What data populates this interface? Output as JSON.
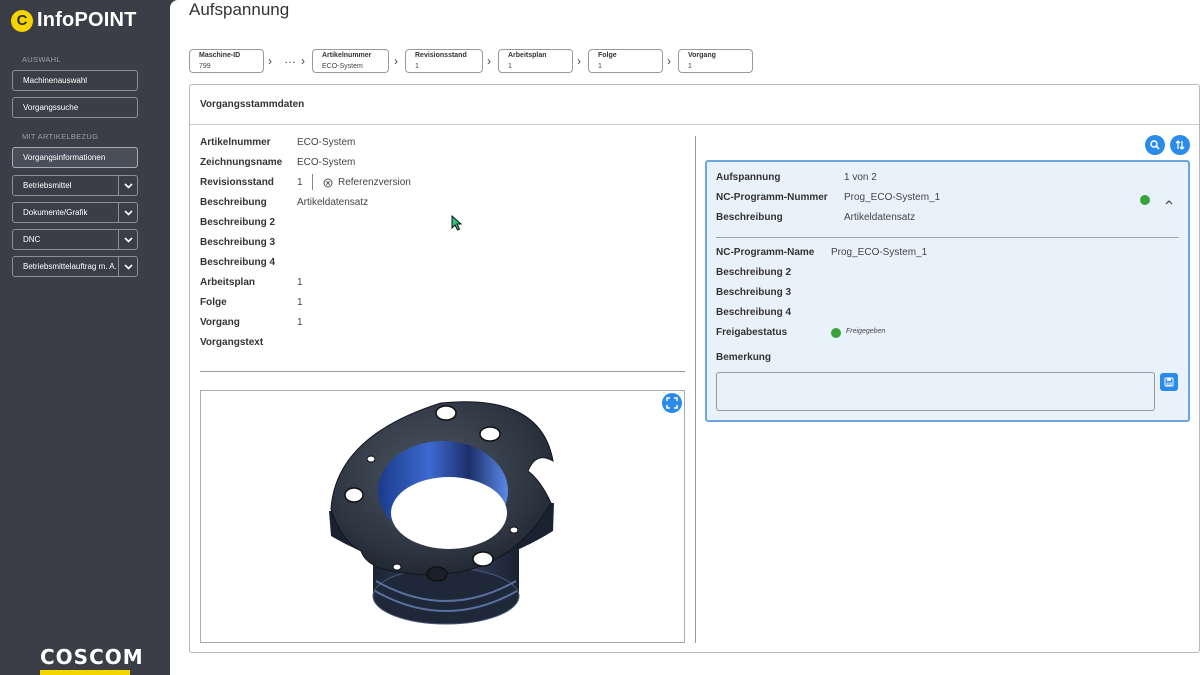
{
  "app": {
    "name": "InfoPOINT",
    "logo_letter": "C",
    "brand_footer": "COSCOM",
    "accent": "#f5d500"
  },
  "sidebar": {
    "section_auswahl": "AUSWAHL",
    "section_artikel": "MIT ARTIKELBEZUG",
    "items": [
      {
        "label": "Machinenauswahl"
      },
      {
        "label": "Vorgangssuche"
      },
      {
        "label": "Vorgangsinformationen"
      },
      {
        "label": "Betriebsmittel"
      },
      {
        "label": "Dokumente/Grafik"
      },
      {
        "label": "DNC"
      },
      {
        "label": "Betriebsmittelauftrag m. A."
      }
    ]
  },
  "page": {
    "title": "Aufspannung"
  },
  "breadcrumb": {
    "ellipsis": "…",
    "items": [
      {
        "key": "Maschine-ID",
        "value": "799"
      },
      {
        "key": "Artikelnummer",
        "value": "ECO-System"
      },
      {
        "key": "Revisionsstand",
        "value": "1"
      },
      {
        "key": "Arbeitsplan",
        "value": "1"
      },
      {
        "key": "Folge",
        "value": "1"
      },
      {
        "key": "Vorgang",
        "value": "1"
      }
    ]
  },
  "card": {
    "title": "Vorgangsstammdaten"
  },
  "left_fields": [
    {
      "label": "Artikelnummer",
      "value": "ECO-System"
    },
    {
      "label": "Zeichnungsname",
      "value": "ECO-System"
    },
    {
      "label": "Revisionsstand",
      "value": "1"
    },
    {
      "label": "Beschreibung",
      "value": "Artikeldatensatz"
    },
    {
      "label": "Beschreibung 2",
      "value": ""
    },
    {
      "label": "Beschreibung 3",
      "value": ""
    },
    {
      "label": "Beschreibung 4",
      "value": ""
    },
    {
      "label": "Arbeitsplan",
      "value": "1"
    },
    {
      "label": "Folge",
      "value": "1"
    },
    {
      "label": "Vorgang",
      "value": "1"
    },
    {
      "label": "Vorgangstext",
      "value": ""
    }
  ],
  "reference_version": "Referenzversion",
  "detail": {
    "aufspannung_label": "Aufspannung",
    "aufspannung_value": "1 von 2",
    "nc_nr_label": "NC-Programm-Nummer",
    "nc_nr_value": "Prog_ECO-System_1",
    "beschreibung_label": "Beschreibung",
    "beschreibung_value": "Artikeldatensatz",
    "nc_name_label": "NC-Programm-Name",
    "nc_name_value": "Prog_ECO-System_1",
    "b2_label": "Beschreibung 2",
    "b3_label": "Beschreibung 3",
    "b4_label": "Beschreibung 4",
    "freigabe_label": "Freigabestatus",
    "freigabe_value": "Freigegeben",
    "status_color": "#3aa23a",
    "bemerkung_label": "Bemerkung",
    "bemerkung_value": ""
  }
}
